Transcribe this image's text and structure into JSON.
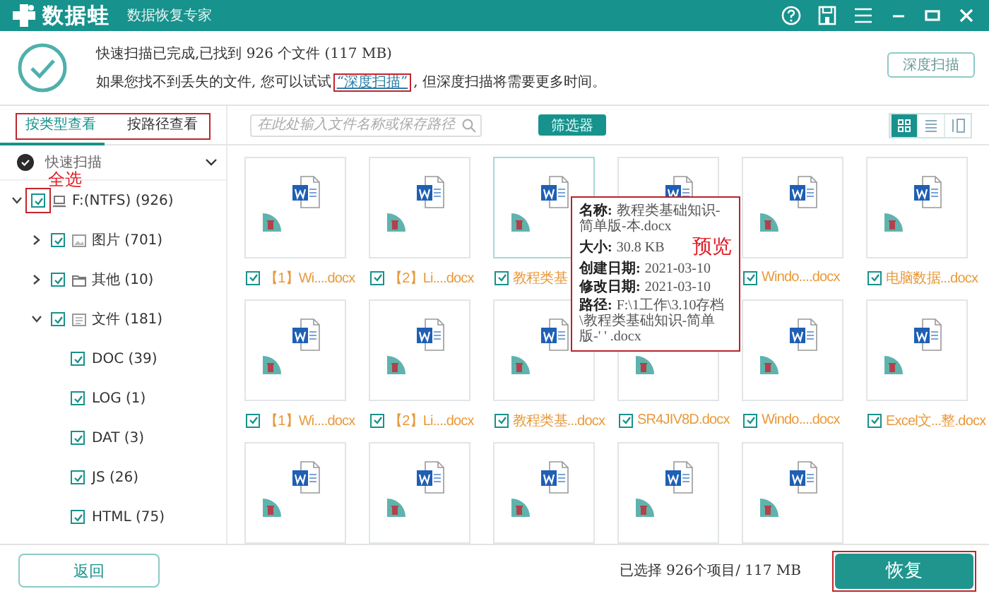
{
  "window": {
    "app_name": "数据蛙",
    "subtitle": "数据恢复专家"
  },
  "titlebar_buttons": [
    {
      "kind": "help"
    },
    {
      "kind": "save"
    },
    {
      "kind": "menu"
    },
    {
      "kind": "minimize"
    },
    {
      "kind": "maximize"
    },
    {
      "kind": "close"
    }
  ],
  "scan_summary": {
    "status": "快速扫描已完成,已找到 926 个文件 (117 MB)",
    "hint_before": "如果您找不到丢失的文件, 您可以试试",
    "link": {
      "text": "“深度扫描”",
      "highlighted": true
    },
    "hint_after": ", 但深度扫描将需要更多时间。",
    "deep_scan_button": "深度扫描"
  },
  "view_tabs": {
    "highlighted": true,
    "items": [
      {
        "label": "按类型查看",
        "selected": true
      },
      {
        "label": "按路径查看",
        "selected": false
      }
    ]
  },
  "sidebar": {
    "scan_mode": "快速扫描",
    "tree": [
      {
        "label": "F:(NTFS) (926)",
        "kind": "drive",
        "checked": true,
        "expanded": true,
        "highlighted": true,
        "annotation": "全选",
        "children": [
          {
            "label": "图片 (701)",
            "kind": "image",
            "checked": true,
            "expanded": false
          },
          {
            "label": "其他 (10)",
            "kind": "folder",
            "checked": true,
            "expanded": false
          },
          {
            "label": "文件 (181)",
            "kind": "document",
            "checked": true,
            "expanded": true,
            "children": [
              {
                "label": "DOC (39)",
                "checked": true
              },
              {
                "label": "LOG (1)",
                "checked": true
              },
              {
                "label": "DAT (3)",
                "checked": true
              },
              {
                "label": "JS (26)",
                "checked": true
              },
              {
                "label": "HTML (75)",
                "checked": true
              }
            ]
          }
        ]
      }
    ]
  },
  "toolbar": {
    "search": {
      "placeholder": "在此处输入文件名称或保存路径"
    },
    "filter_button": "筛选器",
    "view_modes": [
      {
        "kind": "grid",
        "selected": true
      },
      {
        "kind": "list",
        "selected": false
      },
      {
        "kind": "detail",
        "selected": false
      }
    ]
  },
  "files": [
    {
      "kind": "docx",
      "label": "【1】Wi....docx",
      "checked": true,
      "hovered": false
    },
    {
      "kind": "docx",
      "label": "【2】Li....docx",
      "checked": true,
      "hovered": false
    },
    {
      "kind": "docx",
      "label": "教程类基",
      "checked": true,
      "hovered": true
    },
    {
      "kind": "word"
    },
    {
      "kind": "docx",
      "label": "Windo....docx",
      "checked": true,
      "hovered": false
    },
    {
      "kind": "docx",
      "label": "电脑数据...docx",
      "checked": true,
      "hovered": false
    },
    {
      "kind": "docx",
      "label": "【1】Wi....docx",
      "checked": true,
      "hovered": false
    },
    {
      "kind": "docx",
      "label": "【2】Li....docx",
      "checked": true,
      "hovered": false
    },
    {
      "kind": "docx",
      "label": "教程类基...docx",
      "checked": true,
      "hovered": false
    },
    {
      "kind": "deleted",
      "label": "SR4JIV8D.docx",
      "checked": true,
      "hovered": false
    },
    {
      "kind": "docx",
      "label": "Windo....docx",
      "checked": true,
      "hovered": false
    },
    {
      "kind": "docx",
      "label": "Excel文...整.docx",
      "checked": true,
      "hovered": false
    },
    {
      "kind": "docx"
    },
    {
      "kind": "docx"
    },
    {
      "kind": "docx"
    },
    {
      "kind": "docx"
    },
    {
      "kind": "docx"
    }
  ],
  "preview": {
    "annotation": "预览",
    "fields": [
      {
        "label": "名称:",
        "value": "教程类基础知识-简单版-本.docx"
      },
      {
        "label": "大小:",
        "value": "30.8 KB"
      },
      {
        "label": "创建日期:",
        "value": "2021-03-10"
      },
      {
        "label": "修改日期:",
        "value": "2021-03-10"
      },
      {
        "label": "路径:",
        "value": "F:\\1工作\\3.10存档\\教程类基础知识-简单版-' ' .docx"
      }
    ]
  },
  "footer": {
    "back_button": "返回",
    "selection_status": "已选择 926个项目/ 117 MB",
    "recover_button": {
      "label": "恢复",
      "highlighted": true
    }
  }
}
